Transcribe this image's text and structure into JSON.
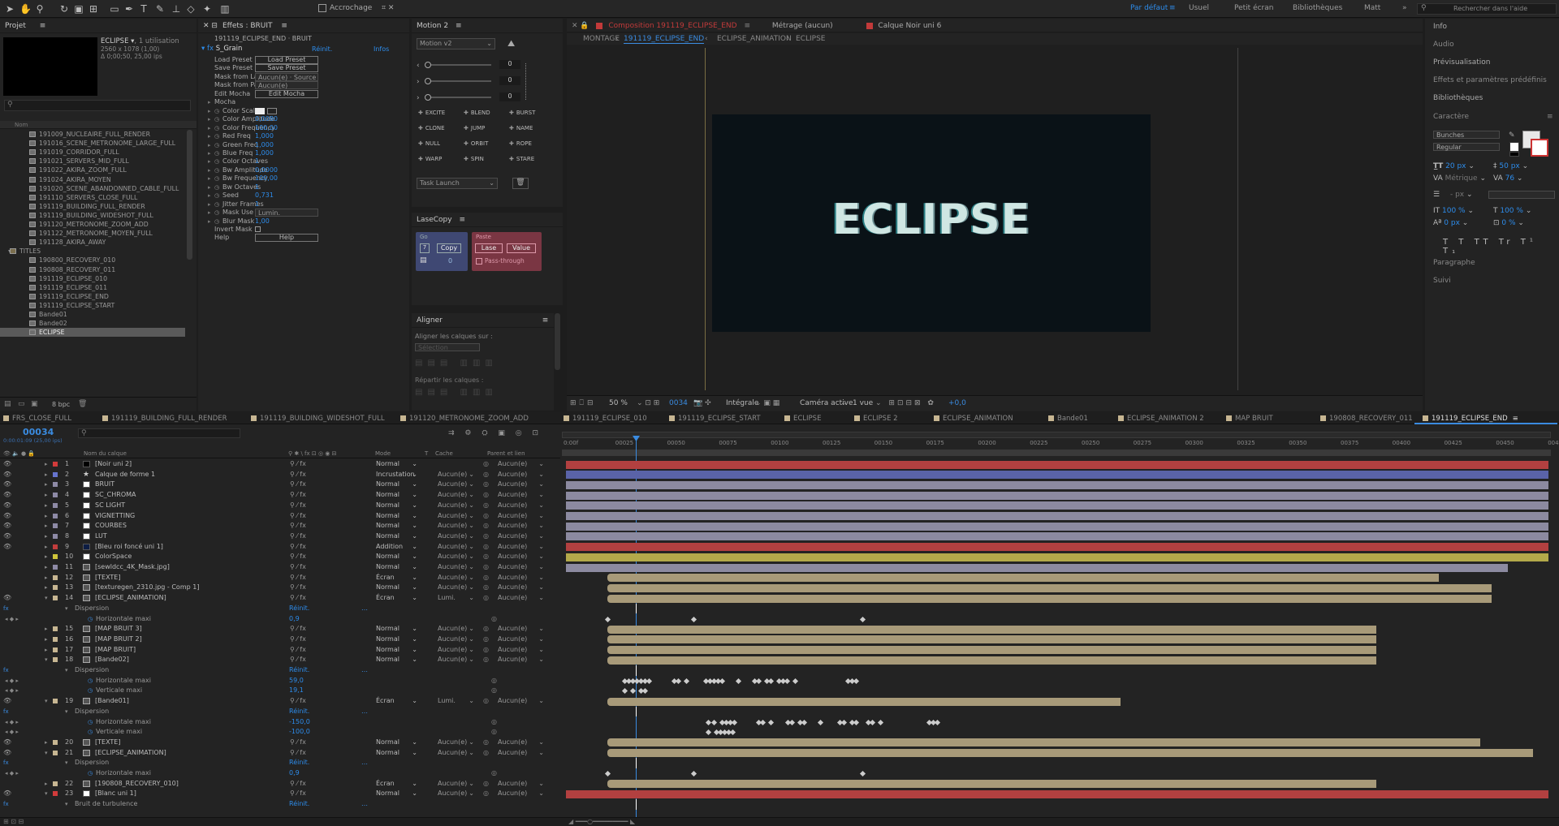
{
  "toolbar": {
    "snap": "Accrochage",
    "workspaces": [
      "Par défaut",
      "Usuel",
      "Petit écran",
      "Bibliothèques",
      "Matt"
    ],
    "search_placeholder": "Rechercher dans l'aide"
  },
  "project": {
    "title": "Projet",
    "item_name": "ECLIPSE ▾",
    "item_usage": ", 1 utilisation",
    "item_size": "2560 x 1078 (1,00)",
    "item_duration": "Δ 0;00;50, 25,00 ips",
    "col_name": "Nom",
    "items": [
      "191009_NUCLEAIRE_FULL_RENDER",
      "191016_SCENE_METRONOME_LARGE_FULL",
      "191019_CORRIDOR_FULL",
      "191021_SERVERS_MID_FULL",
      "191022_AKIRA_ZOOM_FULL",
      "191024_AKIRA_MOYEN",
      "191020_SCENE_ABANDONNED_CABLE_FULL",
      "191110_SERVERS_CLOSE_FULL",
      "191119_BUILDING_FULL_RENDER",
      "191119_BUILDING_WIDESHOT_FULL",
      "191120_METRONOME_ZOOM_ADD",
      "191122_METRONOME_MOYEN_FULL",
      "191128_AKIRA_AWAY",
      "TITLES",
      "190800_RECOVERY_010",
      "190808_RECOVERY_011",
      "191119_ECLIPSE_010",
      "191119_ECLIPSE_011",
      "191119_ECLIPSE_END",
      "191119_ECLIPSE_START",
      "Bande01",
      "Bande02",
      "ECLIPSE"
    ],
    "bpc": "8 bpc"
  },
  "effects": {
    "title": "Effets : BRUIT",
    "breadcrumb": "191119_ECLIPSE_END · BRUIT",
    "fx_name": "S_Grain",
    "reset": "Réinit.",
    "about": "Infos",
    "props": [
      [
        "Load Preset",
        "Load Preset"
      ],
      [
        "Save Preset",
        "Save Preset"
      ],
      [
        "Mask from Layer",
        "Aucun(e) · Source"
      ],
      [
        "Mask from Path",
        "Aucun(e)"
      ],
      [
        "Edit Mocha",
        "Edit Mocha"
      ],
      [
        "Mocha",
        ""
      ],
      [
        "Color Scale",
        ""
      ],
      [
        "Color Amplitude",
        "0,0080"
      ],
      [
        "Color Frequency",
        "100,00"
      ],
      [
        "Red Freq",
        "1,000"
      ],
      [
        "Green Freq",
        "1,000"
      ],
      [
        "Blue Freq",
        "1,000"
      ],
      [
        "Color Octaves",
        "1"
      ],
      [
        "Bw Amplitude",
        "0,0000"
      ],
      [
        "Bw Frequency",
        "100,00"
      ],
      [
        "Bw Octaves",
        "1"
      ],
      [
        "Seed",
        "0,731"
      ],
      [
        "Jitter Frames",
        "1"
      ],
      [
        "Mask Use",
        "Lumin."
      ],
      [
        "Blur Mask",
        "1,00"
      ],
      [
        "Invert Mask",
        ""
      ],
      [
        "Help",
        "Help"
      ]
    ]
  },
  "motion": {
    "title": "Motion 2",
    "dropdown": "Motion v2",
    "values": [
      "0",
      "0",
      "0"
    ],
    "tools": [
      "EXCITE",
      "BLEND",
      "BURST",
      "CLONE",
      "JUMP",
      "NAME",
      "NULL",
      "ORBIT",
      "ROPE",
      "WARP",
      "SPIN",
      "STARE"
    ],
    "task": "Task Launch"
  },
  "lasecopy": {
    "title": "LaseCopy",
    "go": "Go",
    "copy": "Copy",
    "count": "0",
    "paste": "Paste",
    "lase": "Lase",
    "value": "Value",
    "passthrough": "Pass-through",
    "field": "7"
  },
  "aligner": {
    "title": "Aligner",
    "align_to": "Aligner les calques sur :",
    "selection": "Sélection",
    "distribute": "Répartir les calques :"
  },
  "comp": {
    "tabs": [
      "Composition 191119_ECLIPSE_END",
      "Métrage (aucun)",
      "Calque Noir uni 6"
    ],
    "crumbs": [
      "MONTAGE",
      "191119_ECLIPSE_END",
      "ECLIPSE_ANIMATION",
      "ECLIPSE"
    ],
    "title_text": "ECLIPSE",
    "zoom": "50 %",
    "time": "0034",
    "res": "Intégrale",
    "camera": "Caméra active",
    "views": "1 vue",
    "exposure": "+0,0"
  },
  "right": {
    "items": [
      "Info",
      "Audio",
      "Prévisualisation",
      "Effets et paramètres prédéfinis",
      "Bibliothèques",
      "Caractère",
      "Paragraphe",
      "Suivi"
    ],
    "font": "Bunches",
    "style": "Regular",
    "size": "20 px",
    "leading": "50 px",
    "kern": "Métrique",
    "track": "76",
    "unit": "px",
    "vscale": "100 %",
    "hscale": "100 %",
    "baseline": "0 px",
    "tsume": "0 %"
  },
  "timeline": {
    "tabs": [
      "FRS_CLOSE_FULL",
      "191119_BUILDING_FULL_RENDER",
      "191119_BUILDING_WIDESHOT_FULL",
      "191120_METRONOME_ZOOM_ADD",
      "191119_ECLIPSE_010",
      "191119_ECLIPSE_START",
      "ECLIPSE",
      "ECLIPSE 2",
      "ECLIPSE_ANIMATION",
      "Bande01",
      "ECLIPSE_ANIMATION 2",
      "MAP BRUIT",
      "190808_RECOVERY_011",
      "191119_ECLIPSE_END"
    ],
    "timecode": "00034",
    "timecode_sub": "0:00:01:09 (25,00 ips)",
    "col_name": "Nom du calque",
    "col_mode": "Mode",
    "col_T": "T",
    "col_cache": "Cache",
    "col_parent": "Parent et lien",
    "ruler": [
      "0:00f",
      "00025",
      "00050",
      "00075",
      "00100",
      "00125",
      "00150",
      "00175",
      "00200",
      "00225",
      "00250",
      "00275",
      "00300",
      "00325",
      "00350",
      "00375",
      "00400",
      "00425",
      "00450",
      "00475"
    ],
    "layers": [
      {
        "n": "1",
        "name": "[Noir uni 2]",
        "mode": "Normal",
        "cache": "",
        "parent": "Aucun(e)",
        "color": "#d13b3b",
        "sq": "#000"
      },
      {
        "n": "2",
        "name": "Calque de forme 1",
        "mode": "Incrustation",
        "cache": "Aucun(e)",
        "parent": "Aucun(e)",
        "color": "#6674ce",
        "sq": "star"
      },
      {
        "n": "3",
        "name": "BRUIT",
        "mode": "Normal",
        "cache": "Aucun(e)",
        "parent": "Aucun(e)",
        "color": "#8e8aa6",
        "sq": "#fff"
      },
      {
        "n": "4",
        "name": "SC_CHROMA",
        "mode": "Normal",
        "cache": "Aucun(e)",
        "parent": "Aucun(e)",
        "color": "#8e8aa6",
        "sq": "#fff"
      },
      {
        "n": "5",
        "name": "SC LIGHT",
        "mode": "Normal",
        "cache": "Aucun(e)",
        "parent": "Aucun(e)",
        "color": "#8e8aa6",
        "sq": "#fff"
      },
      {
        "n": "6",
        "name": "VIGNETTING",
        "mode": "Normal",
        "cache": "Aucun(e)",
        "parent": "Aucun(e)",
        "color": "#8e8aa6",
        "sq": "#fff"
      },
      {
        "n": "7",
        "name": "COURBES",
        "mode": "Normal",
        "cache": "Aucun(e)",
        "parent": "Aucun(e)",
        "color": "#8e8aa6",
        "sq": "#fff"
      },
      {
        "n": "8",
        "name": "LUT",
        "mode": "Normal",
        "cache": "Aucun(e)",
        "parent": "Aucun(e)",
        "color": "#8e8aa6",
        "sq": "#fff"
      },
      {
        "n": "9",
        "name": "[Bleu roi foncé uni 1]",
        "mode": "Addition",
        "cache": "Aucun(e)",
        "parent": "Aucun(e)",
        "color": "#c23d3d",
        "sq": "#0d1d44"
      },
      {
        "n": "10",
        "name": "ColorSpace",
        "mode": "Normal",
        "cache": "Aucun(e)",
        "parent": "Aucun(e)",
        "color": "#cfc53a",
        "sq": "#fff"
      },
      {
        "n": "11",
        "name": "[sewldcc_4K_Mask.jpg]",
        "mode": "Normal",
        "cache": "Aucun(e)",
        "parent": "Aucun(e)",
        "color": "#8e8aa6",
        "sq": "img"
      },
      {
        "n": "12",
        "name": "[TEXTE]",
        "mode": "Écran",
        "cache": "Aucun(e)",
        "parent": "Aucun(e)",
        "color": "#c7b692",
        "sq": "comp"
      },
      {
        "n": "13",
        "name": "[texturegen_2310.jpg - Comp 1]",
        "mode": "Normal",
        "cache": "Aucun(e)",
        "parent": "Aucun(e)",
        "color": "#c7b692",
        "sq": "comp"
      },
      {
        "n": "14",
        "name": "[ECLIPSE_ANIMATION]",
        "mode": "Écran",
        "cache": "Lumi.",
        "parent": "Aucun(e)",
        "color": "#c7b692",
        "sq": "comp"
      }
    ],
    "layers2": [
      {
        "n": "15",
        "name": "[MAP BRUIT 3]",
        "mode": "Normal",
        "cache": "Aucun(e)",
        "parent": "Aucun(e)"
      },
      {
        "n": "16",
        "name": "[MAP BRUIT 2]",
        "mode": "Normal",
        "cache": "Aucun(e)",
        "parent": "Aucun(e)"
      },
      {
        "n": "17",
        "name": "[MAP BRUIT]",
        "mode": "Normal",
        "cache": "Aucun(e)",
        "parent": "Aucun(e)"
      },
      {
        "n": "18",
        "name": "[Bande02]",
        "mode": "Normal",
        "cache": "Aucun(e)",
        "parent": "Aucun(e)"
      }
    ],
    "layer19": {
      "n": "19",
      "name": "[Bande01]",
      "mode": "Écran",
      "cache": "Lumi.",
      "parent": "Aucun(e)"
    },
    "layers3": [
      {
        "n": "20",
        "name": "[TEXTE]",
        "mode": "Normal",
        "cache": "Aucun(e)",
        "parent": "Aucun(e)"
      },
      {
        "n": "21",
        "name": "[ECLIPSE_ANIMATION]",
        "mode": "Normal",
        "cache": "Aucun(e)",
        "parent": "Aucun(e)"
      }
    ],
    "layers4": [
      {
        "n": "22",
        "name": "[190808_RECOVERY_010]",
        "mode": "Écran",
        "cache": "Aucun(e)",
        "parent": "Aucun(e)"
      },
      {
        "n": "23",
        "name": "[Blanc uni 1]",
        "mode": "Normal",
        "cache": "Aucun(e)",
        "parent": "Aucun(e)"
      }
    ],
    "dispersion": "Dispersion",
    "reset": "Réinit.",
    "hmax": "Horizontale maxi",
    "vmax": "Verticale maxi",
    "v14": "0,9",
    "v18h": "59,0",
    "v18v": "19,1",
    "v19h": "-150,0",
    "v19v": "-100,0",
    "v21": "0,9",
    "bruit_turb": "Bruit de turbulence"
  }
}
